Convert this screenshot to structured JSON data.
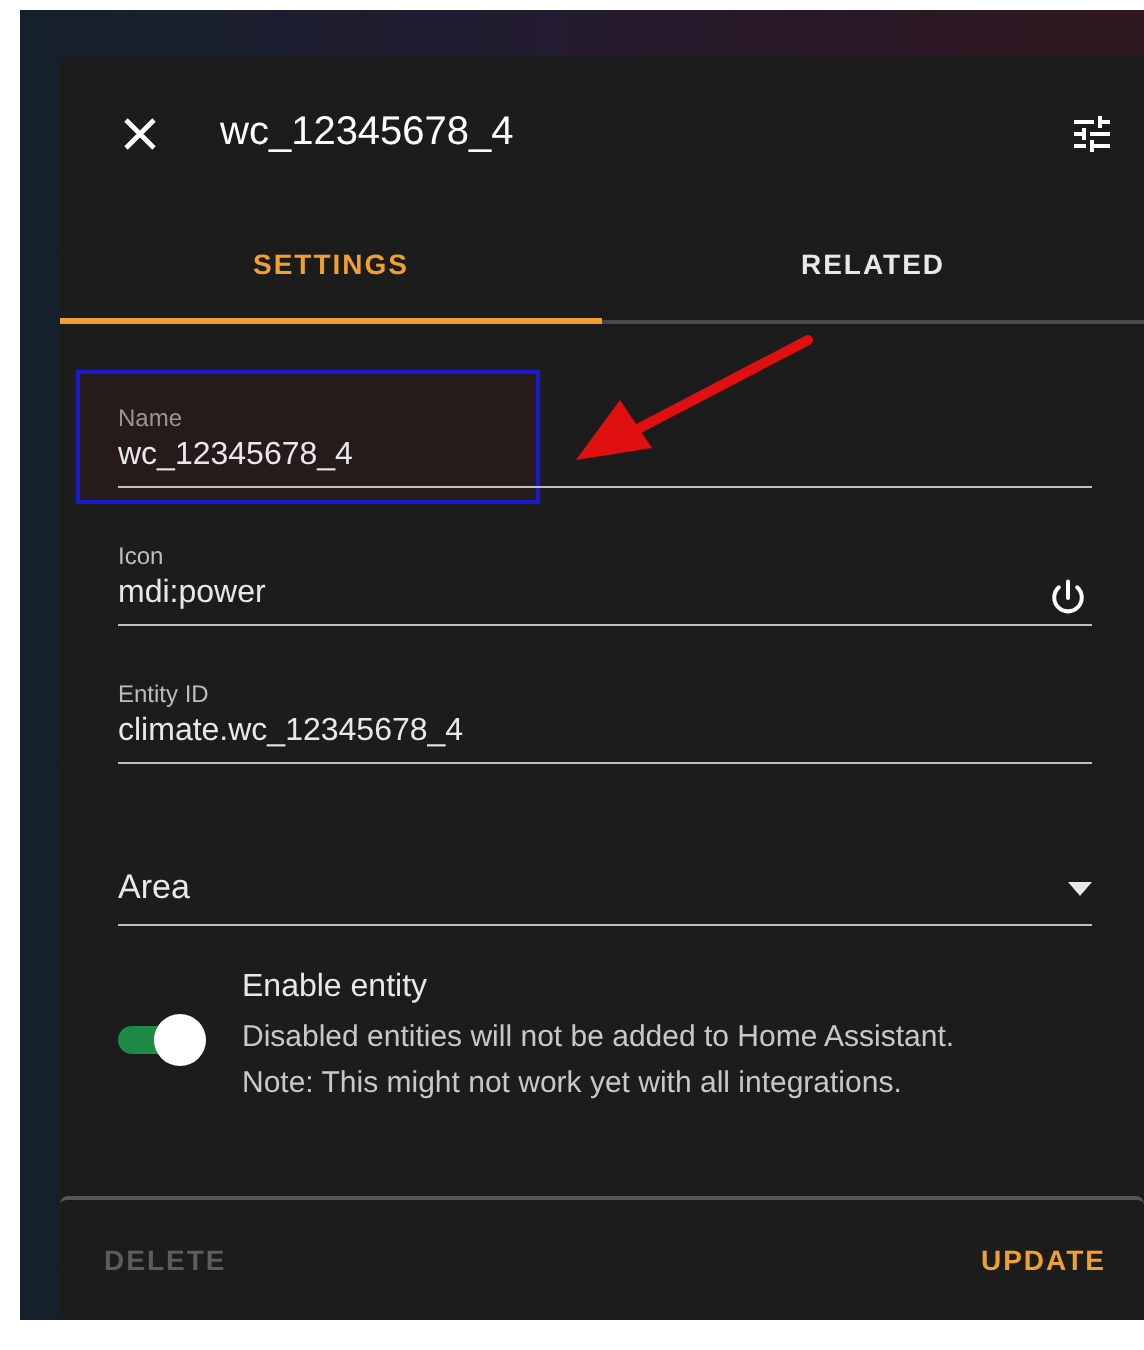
{
  "dialog": {
    "title": "wc_12345678_4"
  },
  "tabs": [
    {
      "label": "SETTINGS",
      "selected": true
    },
    {
      "label": "RELATED",
      "selected": false
    }
  ],
  "fields": [
    {
      "kind": "text",
      "label": "Name",
      "value": "wc_12345678_4",
      "highlighted": true
    },
    {
      "kind": "icon",
      "label": "Icon",
      "value": "mdi:power",
      "highlighted": false
    },
    {
      "kind": "text",
      "label": "Entity ID",
      "value": "climate.wc_12345678_4",
      "highlighted": false
    },
    {
      "kind": "select",
      "placeholder": "Area",
      "highlighted": false
    }
  ],
  "enable": {
    "title": "Enable entity",
    "description": "Disabled entities will not be added to Home Assistant.\nNote: This might not work yet with all integrations.",
    "on": true
  },
  "footer": {
    "delete": {
      "label": "DELETE",
      "disabled": true
    },
    "update": {
      "label": "UPDATE",
      "disabled": false
    }
  }
}
